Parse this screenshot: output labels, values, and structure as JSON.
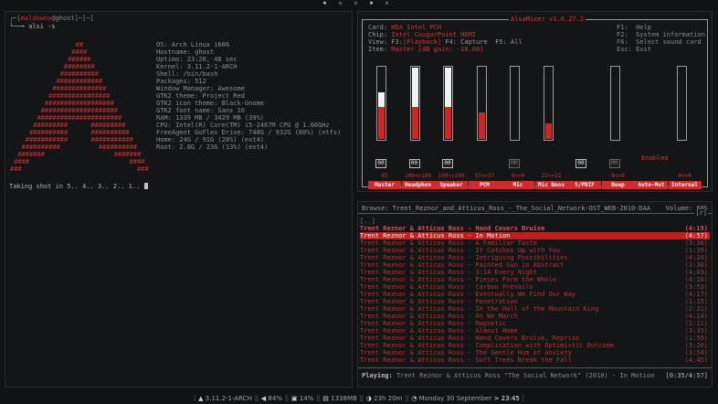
{
  "tags": [
    "▪",
    "▫",
    "▫",
    "▪",
    "▫"
  ],
  "terminal": {
    "user": "maldowns",
    "at": "@",
    "host": "ghost",
    "dir": "~",
    "command": "alsi -s",
    "ascii": "                 ##\n                ####\n               ######\n              ########\n             ##########\n            ############\n           ##############\n          ################\n         ##################\n        ####################\n       ######################\n      #########      #########\n     ##########      ##########\n    ###########      ###########\n   ##########          ##########\n  #######                  #######\n ####                          ####\n###                              ###",
    "info": "OS: Arch Linux i686\nHostname: ghost\nUptime: 23:20, 48 sec\nKernel: 3.11.2-1-ARCH\nShell: /bin/bash\nPackages: 512\nWindow Manager: Awesome\nGTK2 theme: Project Red\nGTK2 icon theme: Black-Gnome\nGTK2 font name: Sans 10\nRAM: 1339 MB / 3429 MB (39%)\nCPU: Intel(R) Core(TM) i5-2467M CPU @ 1.60GHz\nFreeAgent GoFlex Drive: 748G / 932G (80%) (ntfs)\nHome: 24G / 91G (28%) (ext4)\nRoot: 2.8G / 23G (13%) (ext4)",
    "shot": "Taking shot in 5.. 4.. 3.. 2.. 1.. "
  },
  "alsamixer": {
    "title": "AlsaMixer v1.0.27.2",
    "card_label": "Card: ",
    "card": "HDA Intel PCH",
    "chip_label": "Chip: ",
    "chip": "Intel CougarPoint HDMI",
    "view_label": "View: ",
    "view_pre": "F3:",
    "view_active": "[Playback]",
    "view_rest": " F4: Capture  F5: All",
    "item_label": "Item: ",
    "item": "Master [dB gain: -10.00]",
    "help": "F1:  Help\nF2:  System information\nF6:  Select sound card\nEsc: Exit",
    "enabled": "Enabled",
    "channels": [
      {
        "name": "Master",
        "value": "65",
        "white": 0.2,
        "red": 0.45,
        "switch": "00",
        "has_bar": true,
        "selected": true
      },
      {
        "name": "Headphon",
        "value": "100<>100",
        "white": 0.55,
        "red": 0.45,
        "switch": "00",
        "has_bar": true
      },
      {
        "name": "Speaker",
        "value": "100<>100",
        "white": 0.55,
        "red": 0.45,
        "switch": "00",
        "has_bar": true
      },
      {
        "name": "PCM",
        "value": "37<>37",
        "white": 0.0,
        "red": 0.37,
        "switch": "",
        "has_bar": true
      },
      {
        "name": "Mic",
        "value": "0<>0",
        "white": 0.0,
        "red": 0.0,
        "switch": "MM",
        "has_bar": true
      },
      {
        "name": "Mic Boos",
        "value": "22<>22",
        "white": 0.0,
        "red": 0.22,
        "switch": "",
        "has_bar": true
      },
      {
        "name": "S/PDIF",
        "value": "",
        "white": 0.0,
        "red": 0.0,
        "switch": "00",
        "has_bar": false
      },
      {
        "name": "Beep",
        "value": "0<>0",
        "white": 0.0,
        "red": 0.0,
        "switch": "MM",
        "has_bar": true
      },
      {
        "name": "Auto-Mut",
        "value": "",
        "white": 0.0,
        "red": 0.0,
        "switch": "",
        "has_bar": false
      },
      {
        "name": "Internal",
        "value": "0<>0",
        "white": 0.0,
        "red": 0.0,
        "switch": "",
        "has_bar": true
      }
    ]
  },
  "ncmpcpp": {
    "browse": "Browse: Trent_Reznor_and_Atticus_Ross_-_The_Social_Network-OST_WEB-2010-DAA",
    "volume": "Volume: 60%",
    "mode": "[r]",
    "up": "[..]",
    "tracks": [
      {
        "title": "Trent Reznor & Atticus Ross - Hand Covers Bruise",
        "time": "(4:19)",
        "bold": true
      },
      {
        "title": "Trent Reznor & Atticus Ross - In Motion",
        "time": "(4:57)",
        "selected": true
      },
      {
        "title": "Trent Reznor & Atticus Ross - A Familiar Taste",
        "time": "(3:36)"
      },
      {
        "title": "Trent Reznor & Atticus Ross - It Catches Up with You",
        "time": "(1:39)"
      },
      {
        "title": "Trent Reznor & Atticus Ross - Intriguing Possibilities",
        "time": "(4:24)"
      },
      {
        "title": "Trent Reznor & Atticus Ross - Painted Sun in Abstract",
        "time": "(3:30)"
      },
      {
        "title": "Trent Reznor & Atticus Ross - 3:14 Every Night",
        "time": "(4:03)"
      },
      {
        "title": "Trent Reznor & Atticus Ross - Pieces Form the Whole",
        "time": "(4:16)"
      },
      {
        "title": "Trent Reznor & Atticus Ross - Carbon Prevails",
        "time": "(3:53)"
      },
      {
        "title": "Trent Reznor & Atticus Ross - Eventually We Find Our Way",
        "time": "(4:17)"
      },
      {
        "title": "Trent Reznor & Atticus Ross - Penetration",
        "time": "(1:15)"
      },
      {
        "title": "Trent Reznor & Atticus Ross - In the Hall of the Mountain King",
        "time": "(2:21)"
      },
      {
        "title": "Trent Reznor & Atticus Ross - On We March",
        "time": "(4:14)"
      },
      {
        "title": "Trent Reznor & Atticus Ross - Magnetic",
        "time": "(2:11)"
      },
      {
        "title": "Trent Reznor & Atticus Ross - Almost Home",
        "time": "(3:33)"
      },
      {
        "title": "Trent Reznor & Atticus Ross - Hand Covers Bruise, Reprise",
        "time": "(1:59)"
      },
      {
        "title": "Trent Reznor & Atticus Ross - Complication with Optimistic Outcome",
        "time": "(3:20)"
      },
      {
        "title": "Trent Reznor & Atticus Ross - The Gentle Hum of Anxiety",
        "time": "(3:54)"
      },
      {
        "title": "Trent Reznor & Atticus Ross - Soft Trees Break the Fall",
        "time": "(4:45)"
      }
    ],
    "playing_label": "Playing: ",
    "playing": "Trent Reznor & Atticus Ross \"The Social Network\" (2010) - In Motion",
    "progress": "[0:35/4:57]"
  },
  "statusbar": {
    "kernel_icon": "▲",
    "kernel": "3.11.2-1-ARCH",
    "volume_icon": "◀",
    "volume": "84%",
    "cpu_icon": "▣",
    "cpu": "14%",
    "ram_icon": "▤",
    "ram": "1338MB",
    "uptime_icon": "◑",
    "uptime": "23h 20m",
    "clock_icon": "◔",
    "date": "Monday 30 September",
    "time": "23:45"
  }
}
